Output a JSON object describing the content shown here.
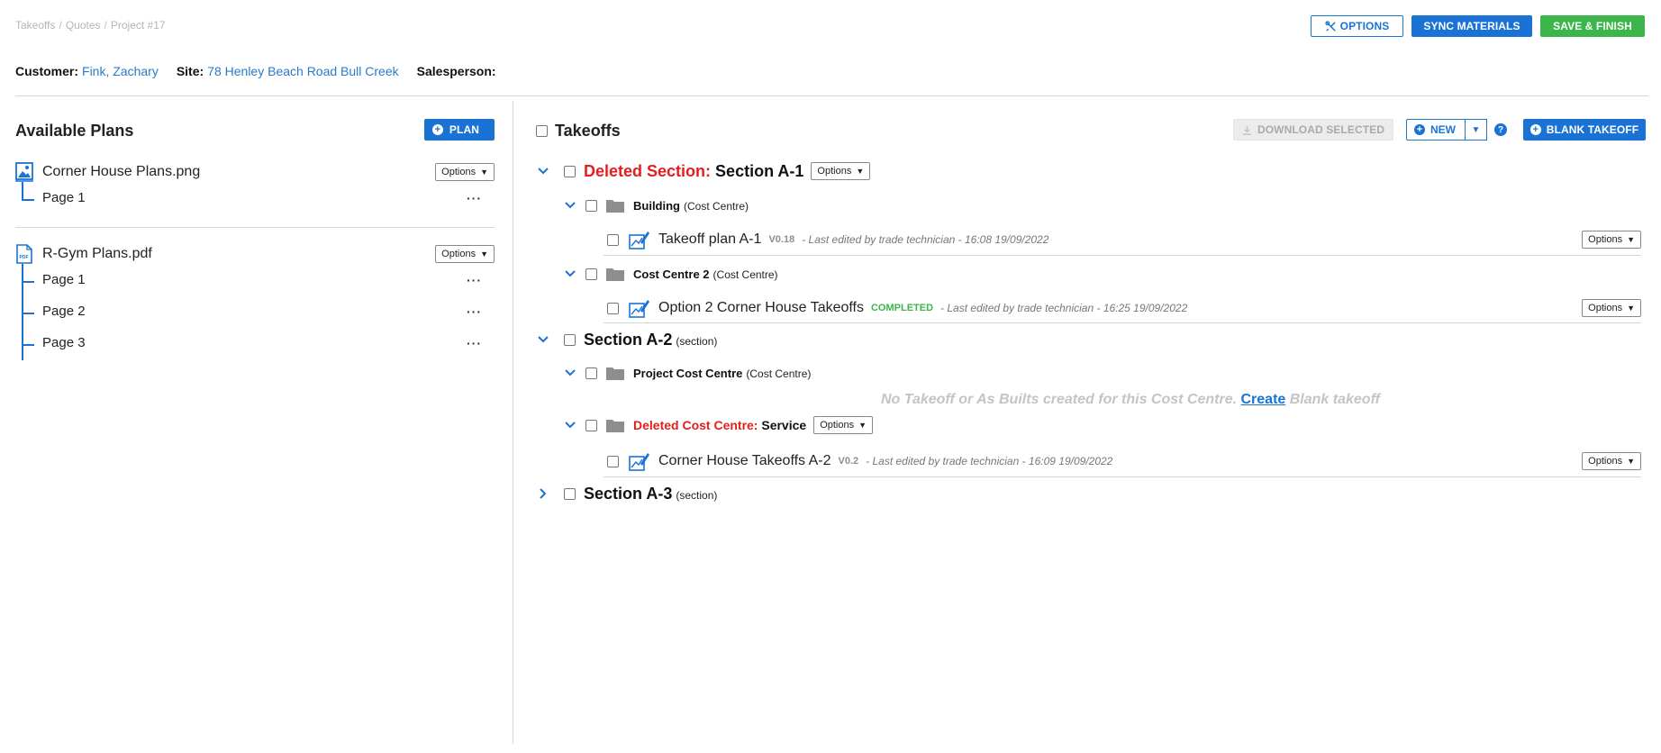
{
  "breadcrumb": {
    "items": [
      "Takeoffs",
      "Quotes",
      "Project #17"
    ],
    "separator": "/"
  },
  "top_actions": {
    "options": "OPTIONS",
    "sync": "SYNC MATERIALS",
    "save": "SAVE & FINISH"
  },
  "info": {
    "customer_label": "Customer:",
    "customer_value": "Fink, Zachary",
    "site_label": "Site:",
    "site_value": "78 Henley Beach Road Bull Creek",
    "salesperson_label": "Salesperson:"
  },
  "left": {
    "title": "Available Plans",
    "plan_button": "PLAN",
    "options_label": "Options",
    "files": [
      {
        "name": "Corner House Plans.png",
        "icon": "image-file-icon",
        "pages": [
          "Page 1"
        ]
      },
      {
        "name": "R-Gym Plans.pdf",
        "icon": "pdf-file-icon",
        "pages": [
          "Page 1",
          "Page 2",
          "Page 3"
        ]
      }
    ],
    "dots": "···"
  },
  "right": {
    "title": "Takeoffs",
    "download": "DOWNLOAD SELECTED",
    "new": "NEW",
    "help": "?",
    "blank": "BLANK TAKEOFF",
    "options_label": "Options",
    "sections": [
      {
        "deleted_prefix": "Deleted Section:",
        "name": "Section A-1",
        "cost_centres": [
          {
            "name": "Building",
            "type": "(Cost Centre)",
            "takeoff": {
              "name": "Takeoff plan A-1",
              "version": "V0.18",
              "edited": "- Last edited by trade technician -  16:08  19/09/2022"
            }
          },
          {
            "name": "Cost Centre 2",
            "type": "(Cost Centre)",
            "takeoff": {
              "name": "Option 2 Corner House Takeoffs",
              "status": "COMPLETED",
              "edited": "- Last edited by trade technician -  16:25  19/09/2022"
            }
          }
        ]
      },
      {
        "name": "Section A-2",
        "type": "(section)",
        "cost_centres": [
          {
            "name": "Project Cost Centre",
            "type": "(Cost Centre)",
            "empty": {
              "before": "No Takeoff or As Builts created for this Cost Centre.",
              "link": "Create",
              "after": "Blank takeoff"
            }
          },
          {
            "deleted_prefix": "Deleted Cost Centre:",
            "name": "Service",
            "takeoff": {
              "name": "Corner House Takeoffs A-2",
              "version": "V0.2",
              "edited": "- Last edited by trade technician -  16:09  19/09/2022"
            }
          }
        ]
      },
      {
        "name": "Section A-3",
        "type": "(section)"
      }
    ]
  },
  "colors": {
    "accent": "#1a73d4",
    "success": "#3cb54a",
    "danger": "#e41e1e",
    "muted": "#c4c4c4"
  }
}
